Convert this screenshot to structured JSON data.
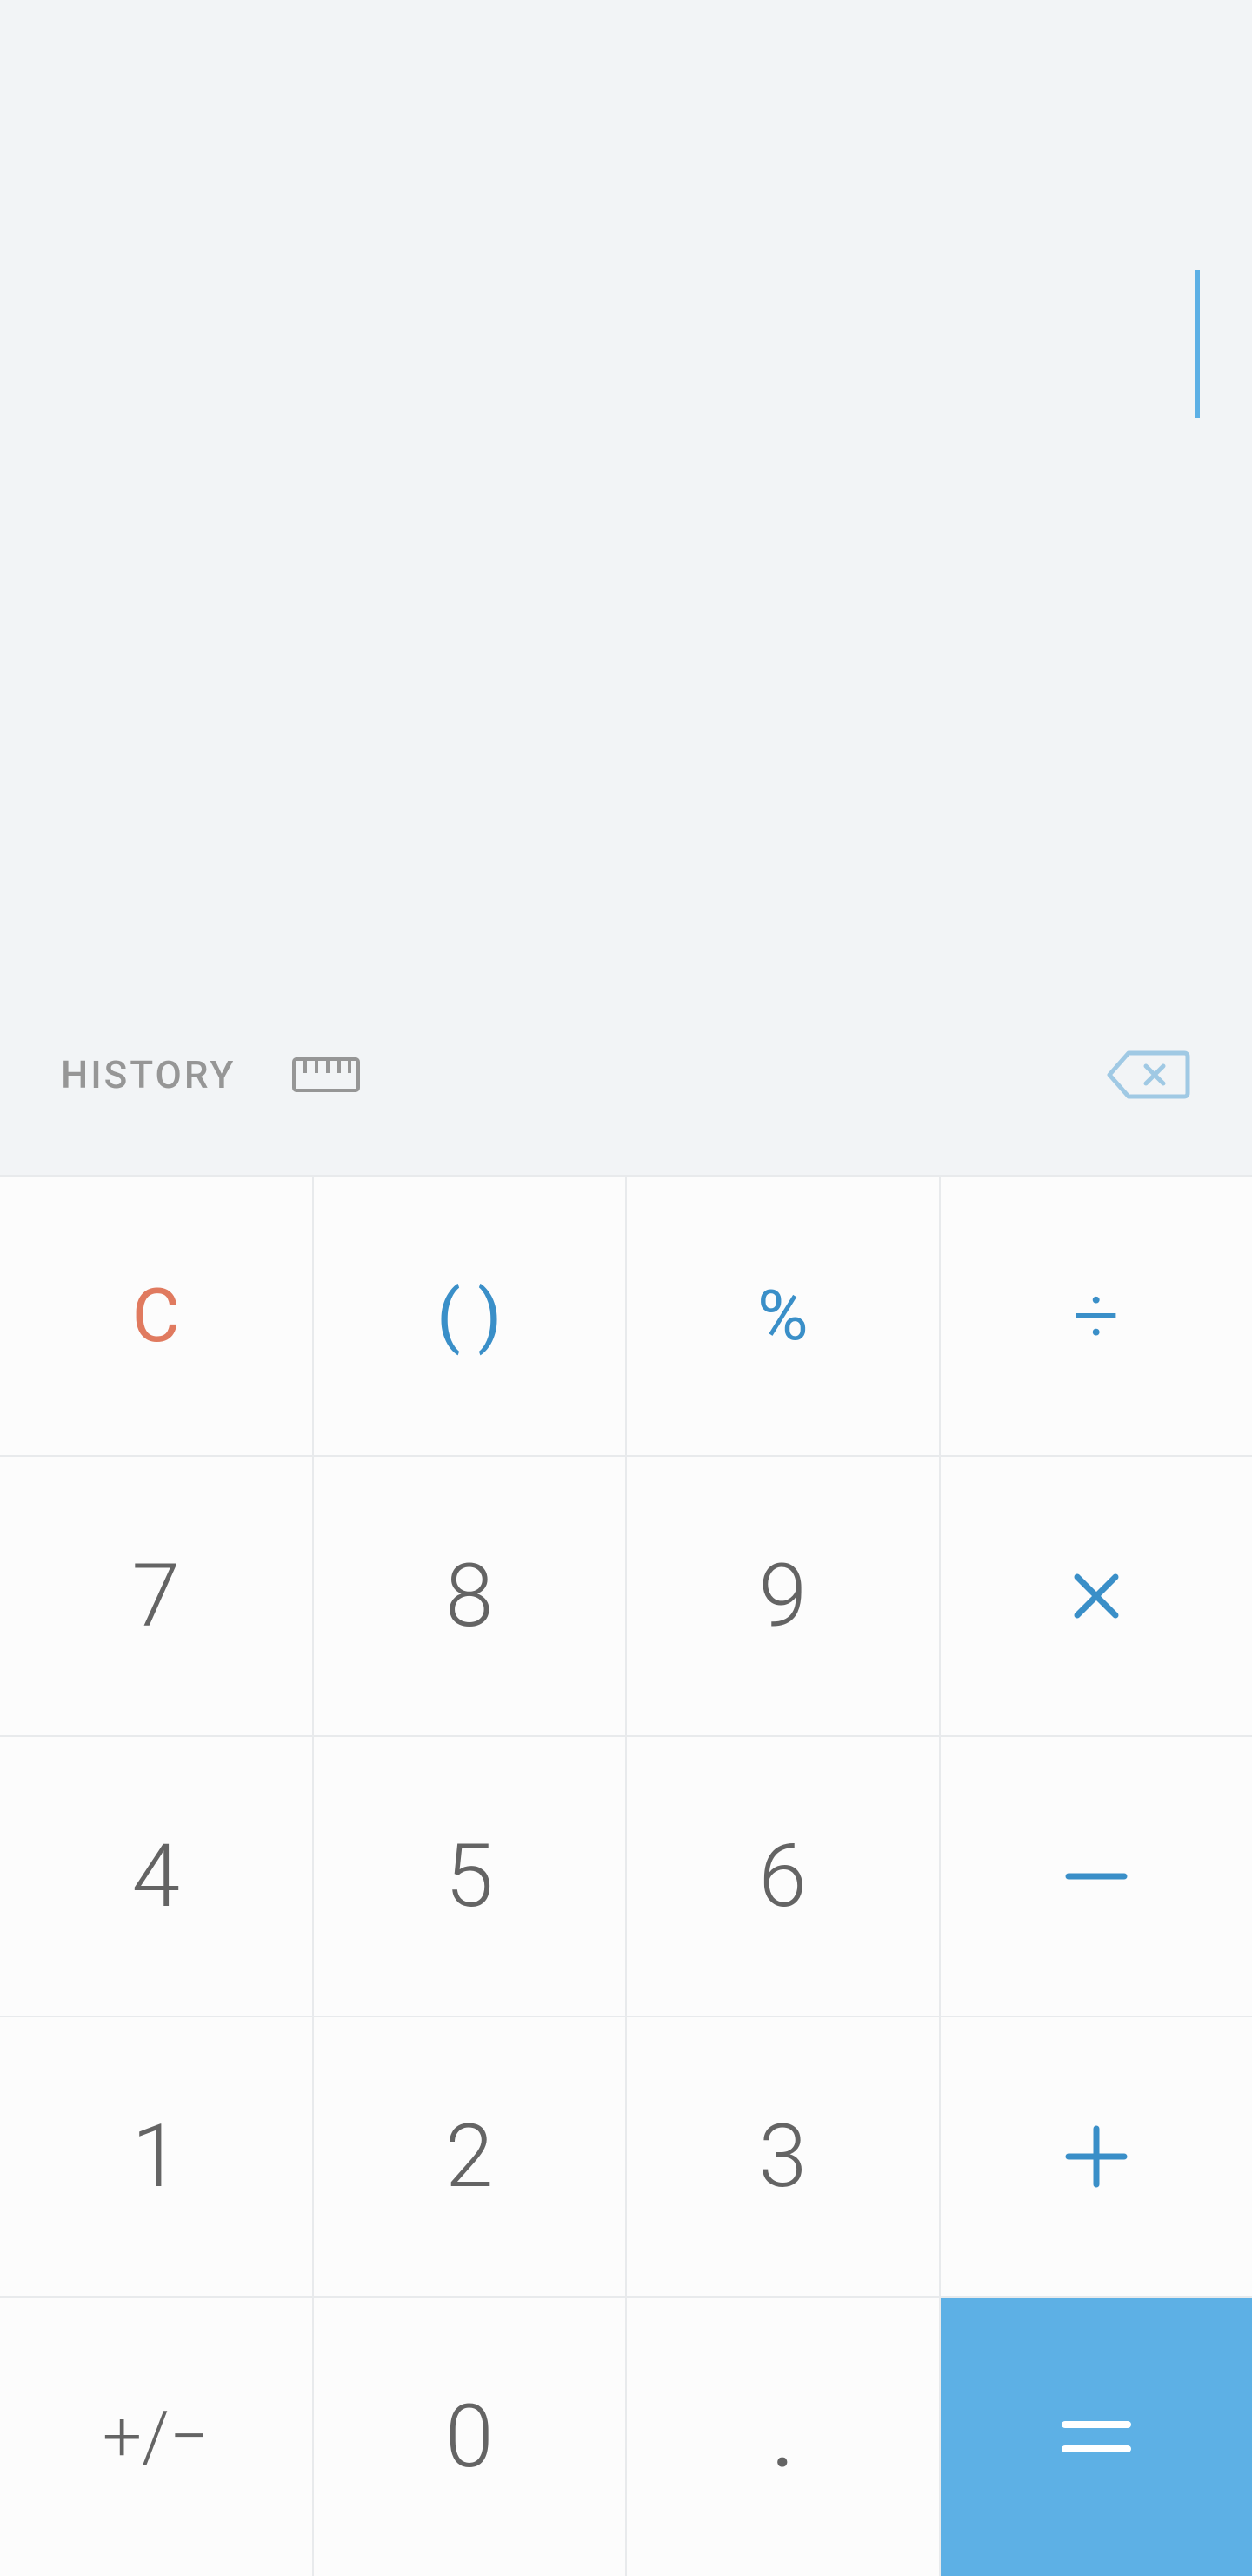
{
  "display": {
    "value": ""
  },
  "toolbar": {
    "history_label": "HISTORY"
  },
  "keypad": {
    "clear": "C",
    "parens": "( )",
    "percent": "%",
    "divide": "÷",
    "seven": "7",
    "eight": "8",
    "nine": "9",
    "multiply": "×",
    "four": "4",
    "five": "5",
    "six": "6",
    "minus": "−",
    "one": "1",
    "two": "2",
    "three": "3",
    "plus": "+",
    "sign": "+/−",
    "zero": "0",
    "decimal": ".",
    "equals": "="
  },
  "colors": {
    "accent": "#5db0e5",
    "operator": "#3a8fc8",
    "clear": "#e07a5f",
    "digit": "#646464",
    "bg_display": "#f2f4f6",
    "bg_key": "#fcfcfc"
  }
}
